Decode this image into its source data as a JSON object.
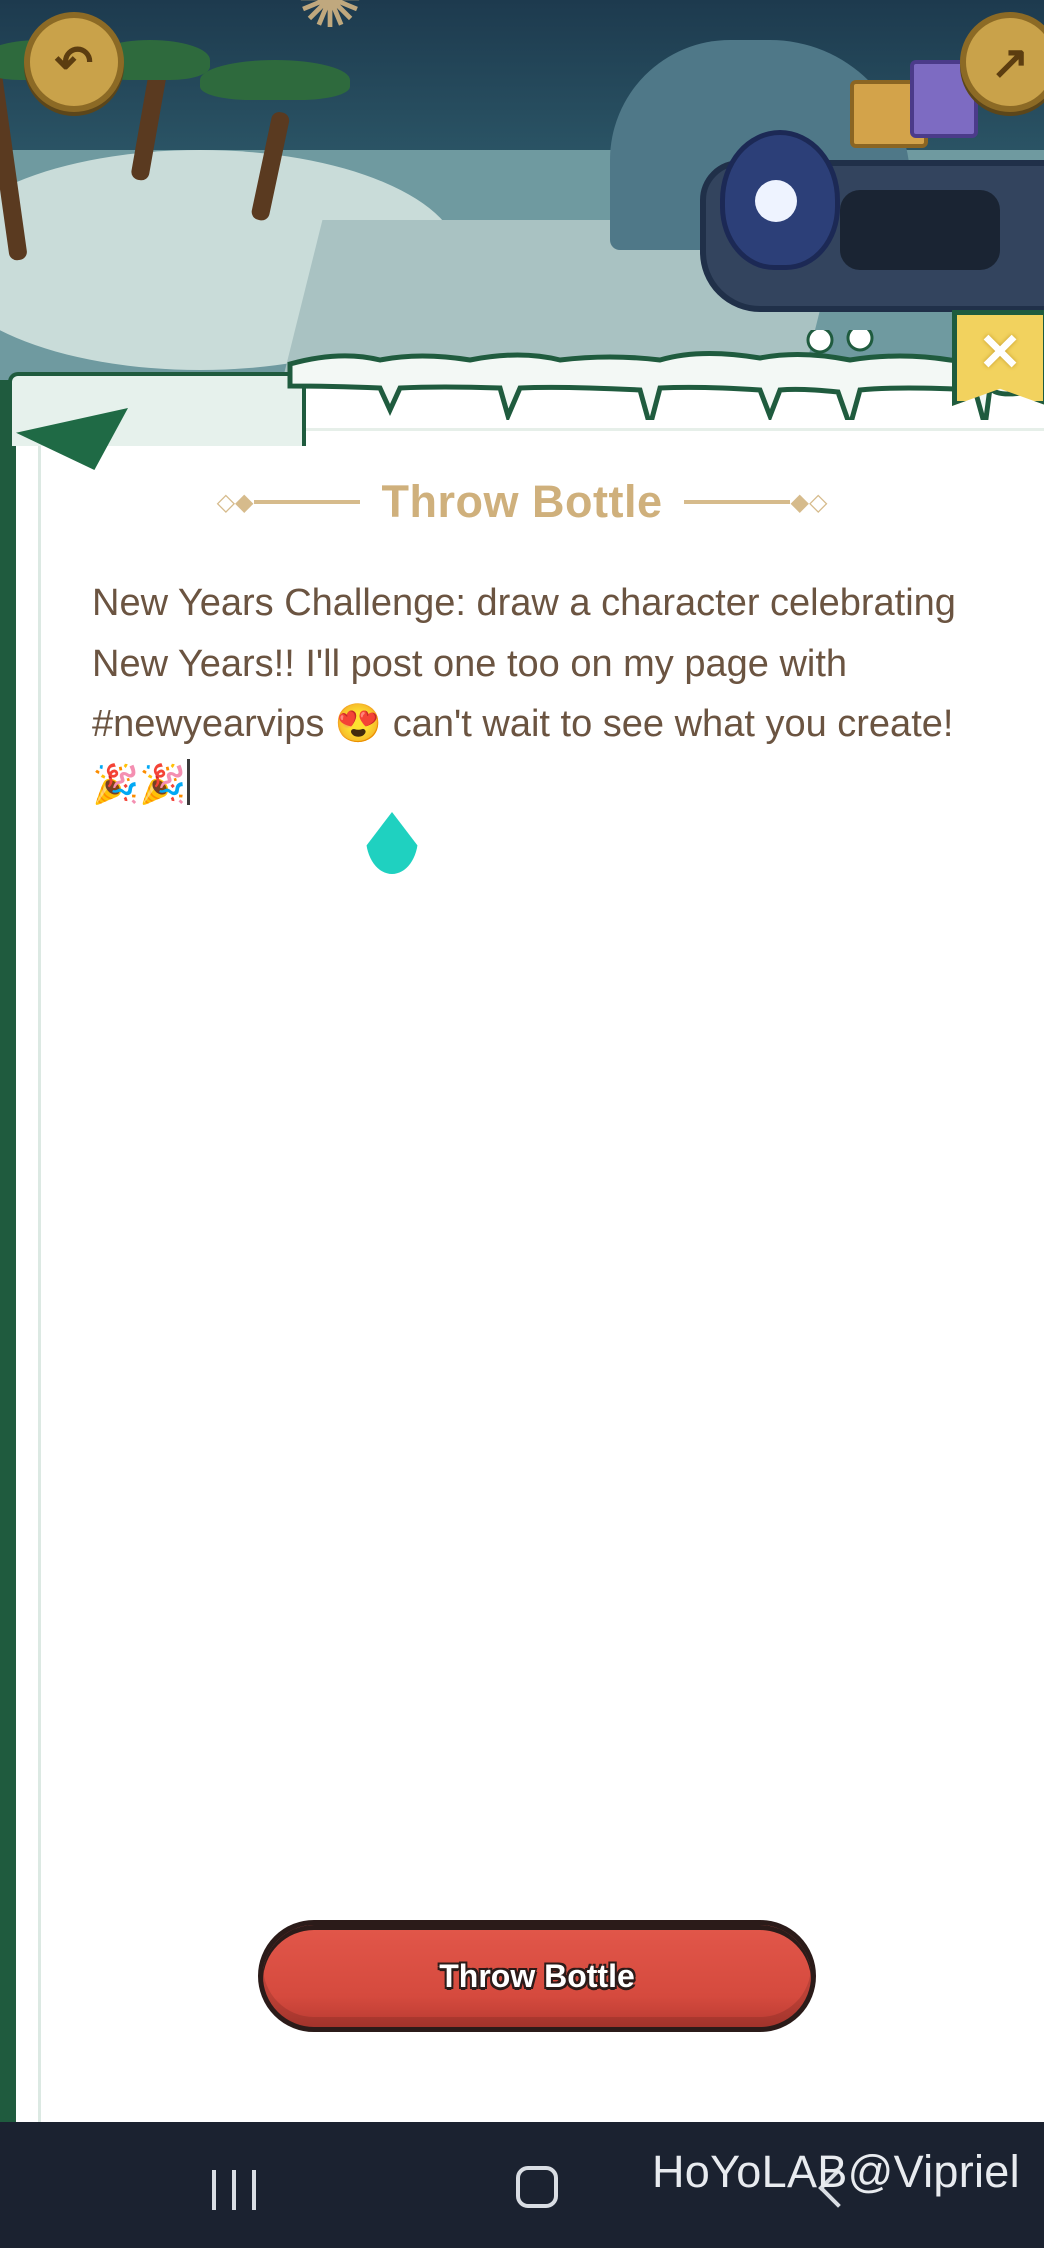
{
  "header": {
    "back_icon": "arrow-back-icon",
    "share_icon": "share-icon"
  },
  "modal": {
    "close_icon": "close-icon",
    "title": "Throw Bottle",
    "message": "New Years Challenge: draw a character celebrating New Years!! I'll post one too on my page with #newyearvips 😍 can't wait to see what you create! 🎉🎉",
    "button_label": "Throw Bottle"
  },
  "navbar": {
    "recents_icon": "recents-icon",
    "home_icon": "home-icon",
    "back_icon": "back-chevron-icon"
  },
  "watermark": "HoYoLAB@Vipriel",
  "colors": {
    "panel_border": "#1f5b3e",
    "title": "#cfb07c",
    "text": "#6b5441",
    "button": "#d54a3e",
    "caret_handle": "#1fd1c0"
  }
}
